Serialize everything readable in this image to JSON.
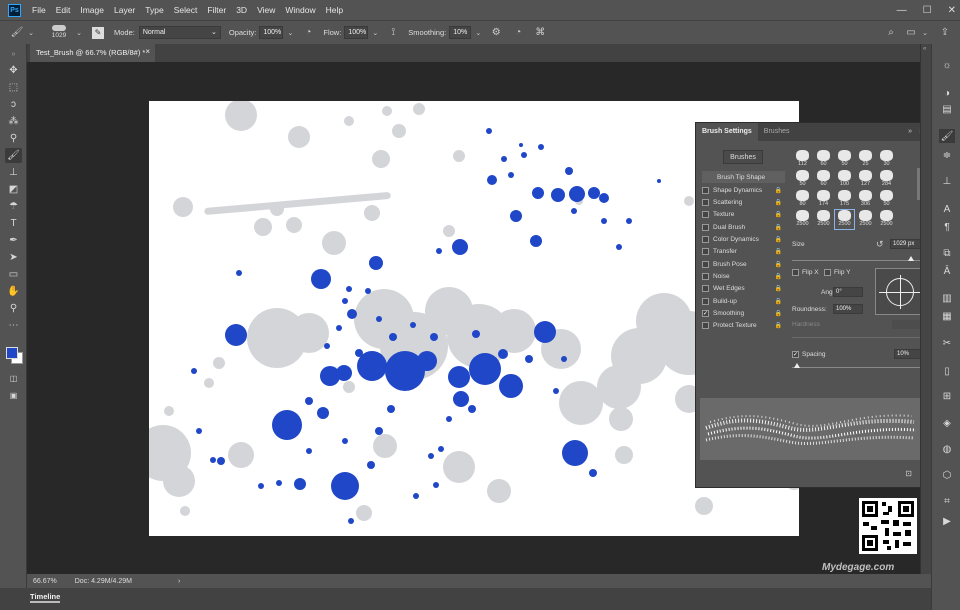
{
  "app": {
    "logo_text": "Ps"
  },
  "menu": {
    "items": [
      "File",
      "Edit",
      "Image",
      "Layer",
      "Type",
      "Select",
      "Filter",
      "3D",
      "View",
      "Window",
      "Help"
    ]
  },
  "window_controls": {
    "minimize": "—",
    "maximize": "☐",
    "close": "✕"
  },
  "options_bar": {
    "brush_size": "1029",
    "mode_label": "Mode:",
    "mode_value": "Normal",
    "opacity_label": "Opacity:",
    "opacity_value": "100%",
    "flow_label": "Flow:",
    "flow_value": "100%",
    "smoothing_label": "Smoothing:",
    "smoothing_value": "10%"
  },
  "document": {
    "tab_title": "Test_Brush @ 66.7% (RGB/8#) *",
    "tab_close": "×"
  },
  "status": {
    "zoom": "66.67%",
    "doc_size": "Doc: 4.29M/4.29M",
    "arrow": "›"
  },
  "timeline": {
    "label": "Timeline"
  },
  "colors": {
    "foreground": "#1f47c8",
    "background": "#ffffff",
    "accent": "#31a8ff"
  },
  "brush_panel": {
    "tabs": [
      "Brush Settings",
      "Brushes"
    ],
    "brushes_button": "Brushes",
    "options": [
      {
        "label": "Brush Tip Shape",
        "checked": false,
        "header": true
      },
      {
        "label": "Shape Dynamics",
        "checked": false
      },
      {
        "label": "Scattering",
        "checked": false
      },
      {
        "label": "Texture",
        "checked": false
      },
      {
        "label": "Dual Brush",
        "checked": false
      },
      {
        "label": "Color Dynamics",
        "checked": false
      },
      {
        "label": "Transfer",
        "checked": false
      },
      {
        "label": "Brush Pose",
        "checked": false
      },
      {
        "label": "Noise",
        "checked": false
      },
      {
        "label": "Wet Edges",
        "checked": false
      },
      {
        "label": "Build-up",
        "checked": false
      },
      {
        "label": "Smoothing",
        "checked": true
      },
      {
        "label": "Protect Texture",
        "checked": false
      }
    ],
    "brush_sizes": [
      "112",
      "60",
      "50",
      "25",
      "30",
      "50",
      "60",
      "100",
      "127",
      "284",
      "80",
      "174",
      "175",
      "306",
      "50",
      "2500",
      "2500",
      "2500",
      "2500",
      "2500"
    ],
    "size_label": "Size",
    "size_value": "1029 px",
    "flip_x": "Flip X",
    "flip_y": "Flip Y",
    "angle_label": "Angle:",
    "angle_value": "0°",
    "roundness_label": "Roundness:",
    "roundness_value": "100%",
    "hardness_label": "Hardness",
    "spacing_label": "Spacing",
    "spacing_value": "10%",
    "spacing_checked": true
  },
  "watermark": "Mydegage.com"
}
